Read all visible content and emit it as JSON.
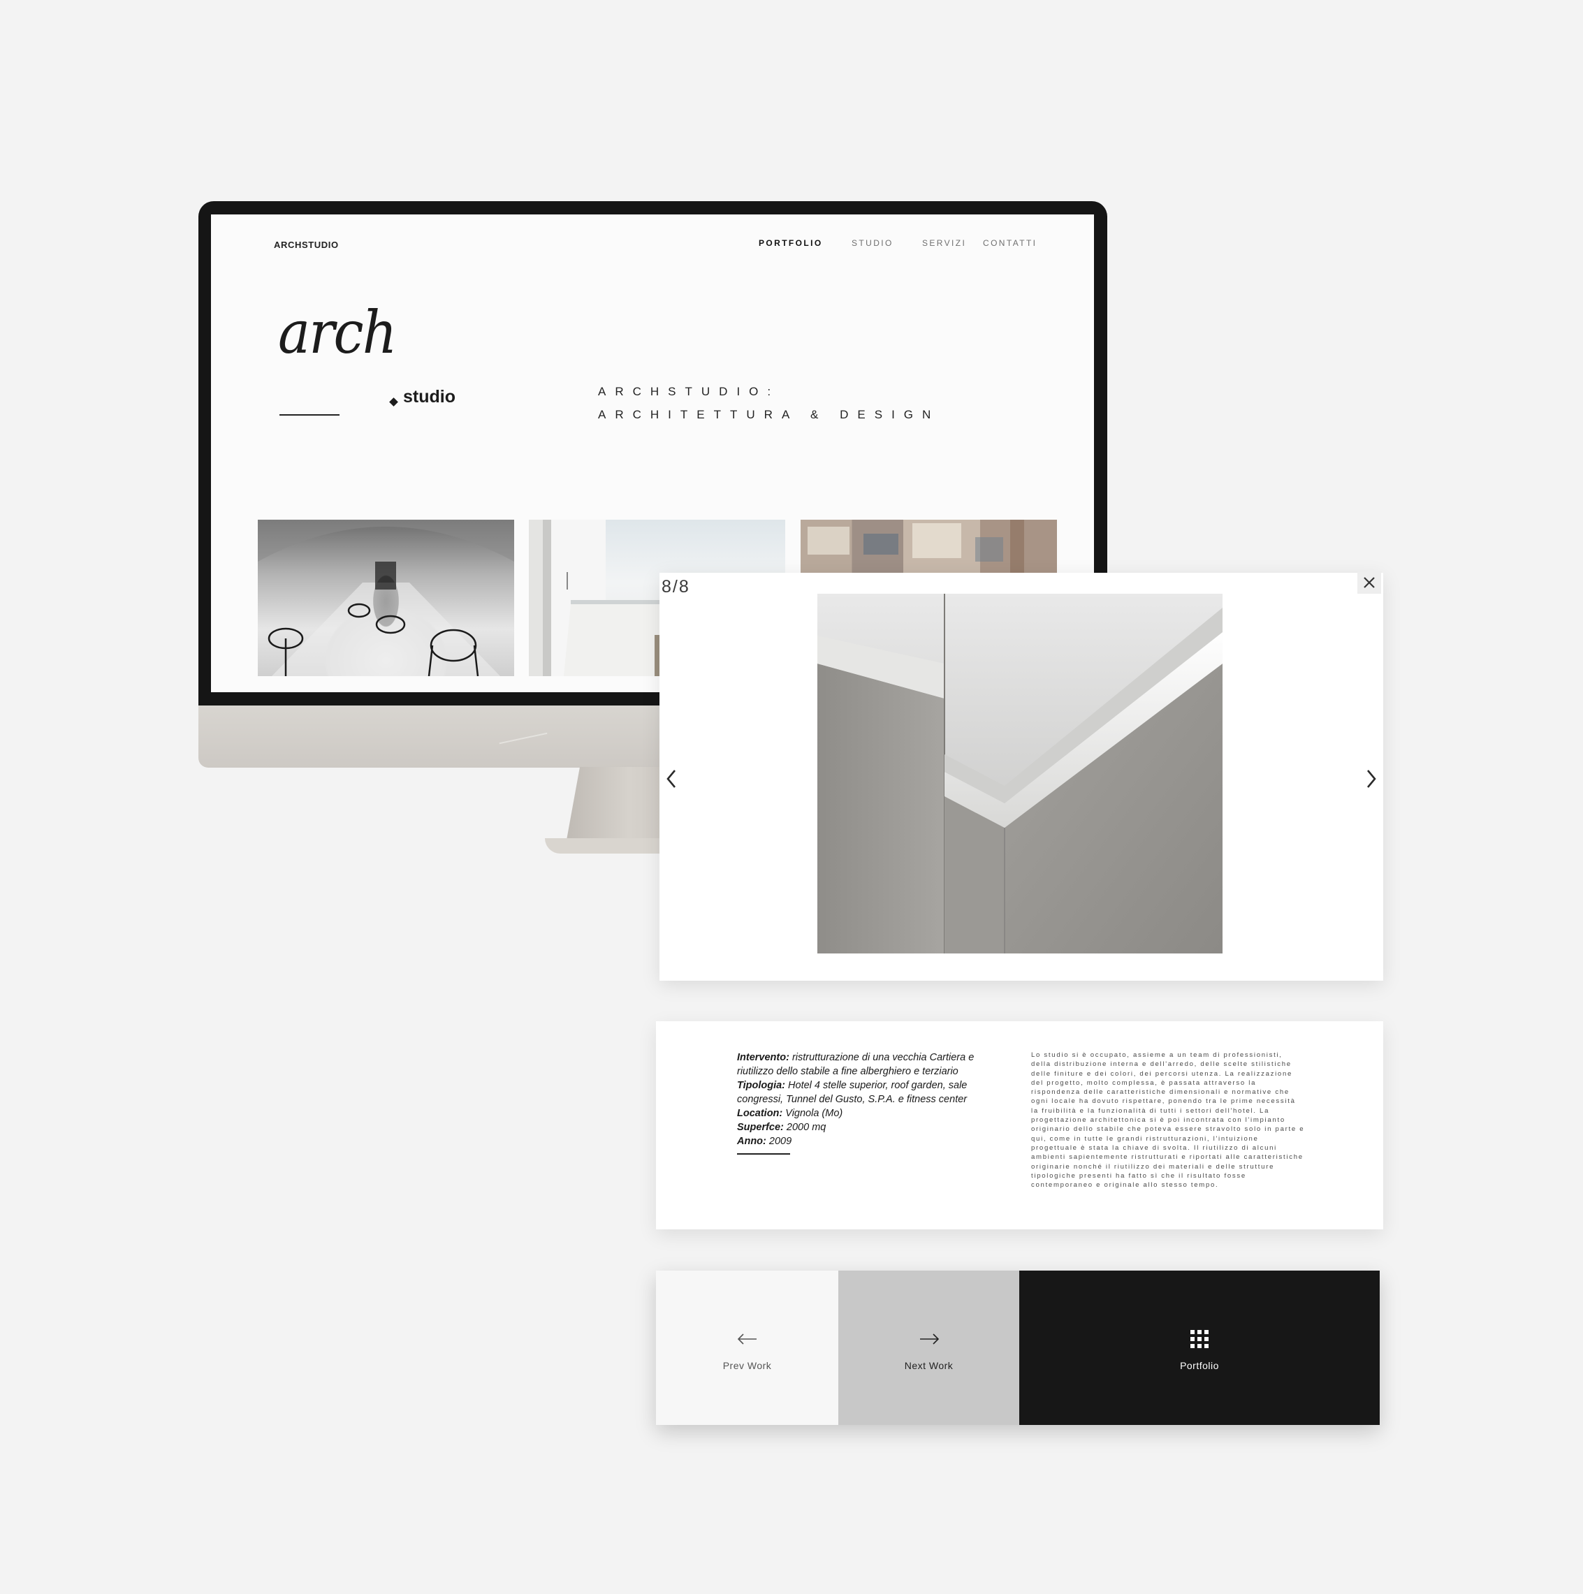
{
  "site": {
    "logo_text": "ARCHSTUDIO",
    "nav": [
      {
        "label": "PORTFOLIO",
        "active": true
      },
      {
        "label": "STUDIO",
        "active": false
      },
      {
        "label": "SERVIZI",
        "active": false
      },
      {
        "label": "CONTATTI",
        "active": false
      }
    ],
    "hero_logo_script": "arch",
    "hero_logo_word": "studio",
    "tagline_line1": "ARCHSTUDIO:",
    "tagline_line2": "ARCHITETTURA & DESIGN"
  },
  "lightbox": {
    "counter": "8/8",
    "close_icon": "close-icon",
    "prev_icon": "chevron-left-icon",
    "next_icon": "chevron-right-icon"
  },
  "project": {
    "intervento_label": "Intervento:",
    "intervento_value": "ristrutturazione di una vecchia Cartiera e riutilizzo dello stabile a fine alberghiero e terziario",
    "tipologia_label": "Tipologia:",
    "tipologia_value": "Hotel 4 stelle superior, roof garden, sale congressi, Tunnel del Gusto, S.P.A. e fitness center",
    "location_label": "Location:",
    "location_value": "Vignola (Mo)",
    "superfice_label": "Superfce:",
    "superfice_value": "2000 mq",
    "anno_label": "Anno:",
    "anno_value": "2009",
    "description": "Lo studio si è occupato, assieme a un team di professionisti, della distribuzione interna e dell'arredo, delle scelte stilistiche delle finiture e dei colori, dei percorsi utenza. La realizzazione del progetto, molto complessa, è passata attraverso la rispondenza delle caratteristiche dimensionali e normative che ogni locale ha dovuto rispettare, ponendo tra le prime necessità la fruibilità e la funzionalità di tutti i settori dell'hotel. La progettazione architettonica si è poi incontrata con l'impianto originario dello stabile che poteva essere stravolto solo in parte e qui, come in tutte le grandi ristrutturazioni, l'intuizione progettuale è stata la chiave di svolta. Il riutilizzo di alcuni ambienti sapientemente ristrutturati e riportati alle caratteristiche originarie nonché il riutilizzo dei materiali e delle strutture tipologiche presenti ha fatto sì che il risultato fosse contemporaneo e originale allo stesso tempo."
  },
  "bottom_nav": {
    "prev": {
      "label": "Prev Work",
      "icon": "arrow-left-icon",
      "bg": "#f7f7f7",
      "fg": "#555555"
    },
    "next": {
      "label": "Next Work",
      "icon": "arrow-right-icon",
      "bg": "#c8c8c8",
      "fg": "#222222"
    },
    "portfolio": {
      "label": "Portfolio",
      "icon": "grid-icon",
      "bg": "#171717",
      "fg": "#ffffff"
    }
  }
}
